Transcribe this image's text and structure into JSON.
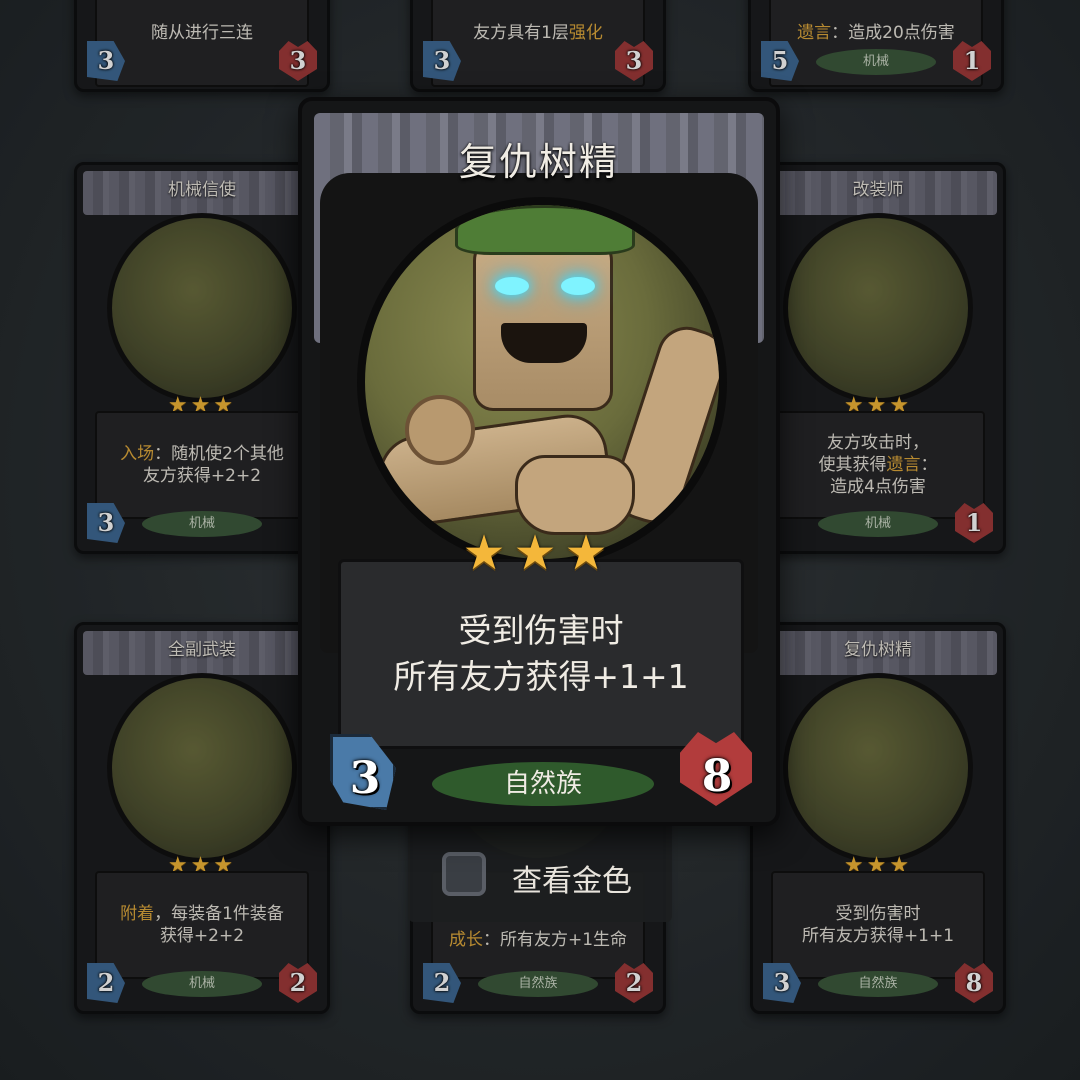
{
  "background_cards": [
    {
      "title": "",
      "text": [
        "随从进行三连"
      ],
      "cost": "3",
      "hp": "3",
      "tribe": ""
    },
    {
      "title": "",
      "text_parts": [
        {
          "t": "友方具有1层",
          "kw": false
        },
        {
          "t": "强化",
          "kw": true
        }
      ],
      "cost": "3",
      "hp": "3",
      "tribe": ""
    },
    {
      "title": "",
      "text_parts": [
        {
          "t": "遗言",
          "kw": true
        },
        {
          "t": "：造成20点伤害",
          "kw": false
        }
      ],
      "cost": "5",
      "hp": "1",
      "tribe": "机械"
    },
    {
      "title": "机械信使",
      "text_parts": [
        {
          "t": "入场",
          "kw": true
        },
        {
          "t": "：随机使2个其他",
          "kw": false
        }
      ],
      "text2": "友方获得+2+2",
      "cost": "3",
      "hp": "",
      "tribe": "机械"
    },
    {
      "title": "改装师",
      "text": [
        "友方攻击时，"
      ],
      "text_parts": [
        {
          "t": "使其获得",
          "kw": false
        },
        {
          "t": "遗言",
          "kw": true
        },
        {
          "t": "：",
          "kw": false
        }
      ],
      "text2": "造成4点伤害",
      "cost": "",
      "hp": "1",
      "tribe": "机械"
    },
    {
      "title": "全副武装",
      "text_parts": [
        {
          "t": "附着",
          "kw": true
        },
        {
          "t": "，每装备1件装备",
          "kw": false
        }
      ],
      "text2": "获得+2+2",
      "cost": "2",
      "hp": "2",
      "tribe": "机械"
    },
    {
      "title": "",
      "text_parts": [
        {
          "t": "成长",
          "kw": true
        },
        {
          "t": "：所有友方+1生命",
          "kw": false
        }
      ],
      "cost": "2",
      "hp": "2",
      "tribe": "自然族"
    },
    {
      "title": "复仇树精",
      "text": [
        "受到伤害时",
        "所有友方获得+1+1"
      ],
      "cost": "3",
      "hp": "8",
      "tribe": "自然族"
    }
  ],
  "focus_card": {
    "title": "复仇树精",
    "stars": "★★★",
    "text_line1": "受到伤害时",
    "text_line2": "所有友方获得+1+1",
    "cost": "3",
    "hp": "8",
    "tribe": "自然族"
  },
  "golden_toggle": {
    "label": "查看金色",
    "checked": false
  },
  "colors": {
    "keyword": "#e0a93c",
    "cost_blue": "#4a7aa8",
    "hp_red": "#b23c3c",
    "tribe_green": "#2f5a2c",
    "star_gold": "#f4b73a"
  }
}
